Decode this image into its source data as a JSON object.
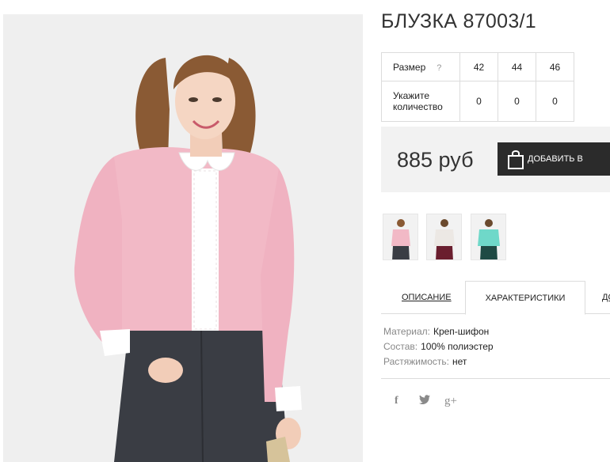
{
  "product": {
    "title": "БЛУЗКА 87003/1"
  },
  "sizes": {
    "size_label": "Размер",
    "help_icon": "?",
    "qty_label_line1": "Укажите",
    "qty_label_line2": "количество",
    "items": [
      {
        "size": "42",
        "qty": "0"
      },
      {
        "size": "44",
        "qty": "0"
      },
      {
        "size": "46",
        "qty": "0"
      }
    ]
  },
  "price": {
    "value": "885 руб",
    "add_button_label": "ДОБАВИТЬ В"
  },
  "thumbnails": [
    {
      "icon": "photo-pink-blouse",
      "color": "#f2b9c6"
    },
    {
      "icon": "photo-white-blouse",
      "color": "#ece8e4"
    },
    {
      "icon": "photo-mint-blouse",
      "color": "#6fd8c9"
    }
  ],
  "tabs": {
    "description": "ОПИСАНИЕ",
    "characteristics": "ХАРАКТЕРИСТИКИ",
    "more": "ДО"
  },
  "specs": [
    {
      "key": "Материал:",
      "value": "Креп-шифон"
    },
    {
      "key": "Состав:",
      "value": "100% полиэстер"
    },
    {
      "key": "Растяжимость:",
      "value": "нет"
    }
  ],
  "social": {
    "facebook": "f",
    "twitter": "🐦",
    "google_plus": "g+"
  },
  "colors": {
    "blouse_pink": "#f2b9c6",
    "jeans": "#3a3d44",
    "button_dark": "#2b2b2b",
    "price_bg": "#f2f2f2"
  }
}
